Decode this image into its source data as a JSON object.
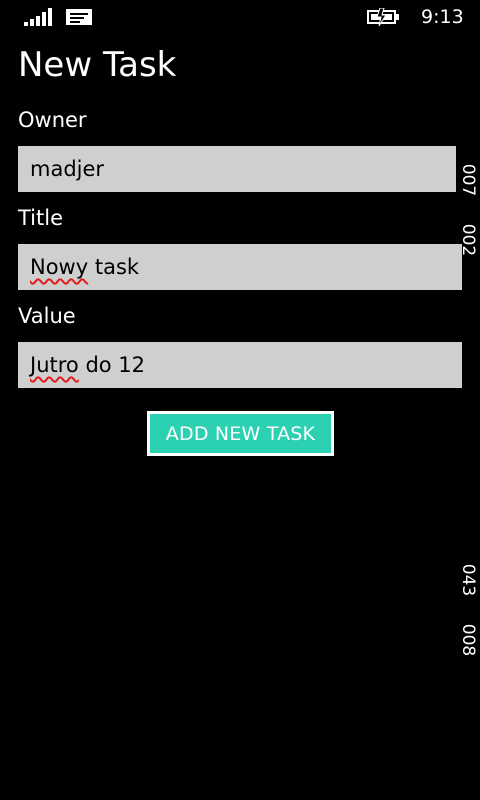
{
  "status_bar": {
    "time": "9:13",
    "icons": [
      "signal-icon",
      "message-icon",
      "battery-icon"
    ]
  },
  "page": {
    "title": "New Task"
  },
  "form": {
    "owner": {
      "label": "Owner",
      "value": "madjer"
    },
    "title": {
      "label": "Title",
      "value_misspelled": "Nowy",
      "value_rest": " task"
    },
    "value": {
      "label": "Value",
      "value_misspelled": "Jutro",
      "value_rest": " do 12"
    },
    "add_button_label": "ADD NEW TASK"
  },
  "side_counters": {
    "top_1": "007",
    "top_2": "002",
    "bottom_1": "043",
    "bottom_2": "008"
  },
  "colors": {
    "background": "#000000",
    "field_background": "#cfcfcf",
    "accent": "#2bd1b1",
    "spell_error": "#e21b1b"
  }
}
